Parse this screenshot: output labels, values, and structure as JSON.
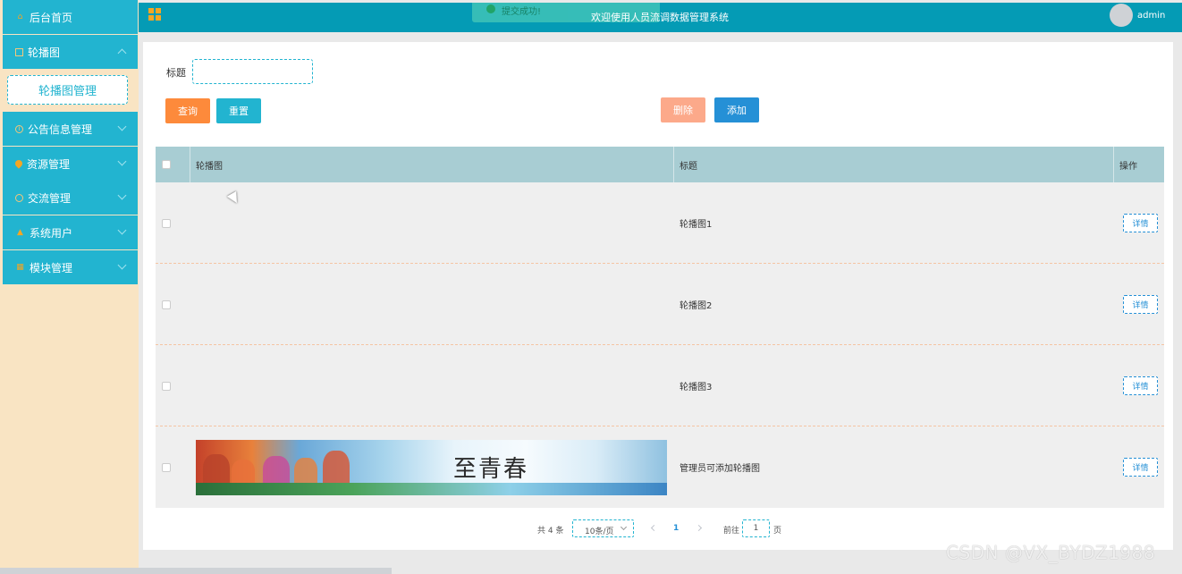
{
  "sidebar": {
    "items": [
      {
        "label": "后台首页",
        "icon": "home-icon"
      },
      {
        "label": "轮播图",
        "icon": "image-icon",
        "expanded": true
      },
      {
        "label": "公告信息管理",
        "icon": "info-icon"
      },
      {
        "label": "资源管理",
        "icon": "location-icon"
      },
      {
        "label": "交流管理",
        "icon": "chat-icon"
      },
      {
        "label": "系统用户",
        "icon": "user-icon"
      },
      {
        "label": "模块管理",
        "icon": "grid-icon"
      }
    ],
    "submenu_label": "轮播图管理"
  },
  "header": {
    "toast": "提交成功!",
    "welcome": "欢迎使用人员流调数据管理系统",
    "user": "admin"
  },
  "search": {
    "label": "标题",
    "value": "",
    "query_button": "查询",
    "reset_button": "重置",
    "delete_button": "删除",
    "add_button": "添加"
  },
  "table": {
    "columns": [
      "轮播图",
      "标题",
      "操作"
    ],
    "rows": [
      {
        "title": "轮播图1",
        "has_image": false
      },
      {
        "title": "轮播图2",
        "has_image": false
      },
      {
        "title": "轮播图3",
        "has_image": false
      },
      {
        "title": "管理员可添加轮播图",
        "has_image": true,
        "image_text": "至青春"
      }
    ],
    "detail_label": "详情"
  },
  "pagination": {
    "total": "共 4 条",
    "page_size": "10条/页",
    "current_page": "1",
    "goto_label": "前往",
    "goto_value": "1",
    "page_suffix": "页"
  },
  "watermark": "CSDN @VX_BYDZ1988",
  "colors": {
    "sidebar_item": "#22b4d0",
    "sidebar_bg": "#f9e4c3",
    "header": "#049bb5",
    "query": "#fd8a3b",
    "reset": "#22b4d0",
    "delete": "#fca98a",
    "add": "#2590d6",
    "table_header": "#a8cdd3"
  }
}
